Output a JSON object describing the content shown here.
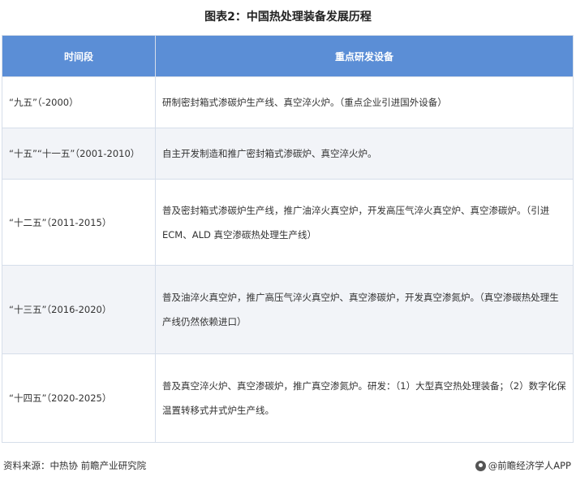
{
  "title": "图表2：中国热处理装备发展历程",
  "table": {
    "headers": [
      "时间段",
      "重点研发设备"
    ],
    "rows": [
      {
        "period": "“九五”（-2000）",
        "equipment": "研制密封箱式渗碳炉生产线、真空淬火炉。（重点企业引进国外设备）"
      },
      {
        "period": "“十五”“十一五”（2001-2010）",
        "equipment": "自主开发制造和推广密封箱式渗碳炉、真空淬火炉。"
      },
      {
        "period": "“十二五”（2011-2015）",
        "equipment": "普及密封箱式渗碳炉生产线，推广油淬火真空炉，开发高压气淬火真空炉、真空渗碳炉。（引进 ECM、ALD 真空渗碳热处理生产线）"
      },
      {
        "period": "“十三五”（2016-2020）",
        "equipment": "普及油淬火真空炉，推广高压气淬火真空炉、真空渗碳炉，开发真空渗氮炉。（真空渗碳热处理生产线仍然依赖进口）"
      },
      {
        "period": "“十四五”（2020-2025）",
        "equipment": "普及真空淬火炉、真空渗碳炉，推广真空渗氮炉。研发：（1）大型真空热处理装备；（2）数字化保温置转移式井式炉生产线。"
      }
    ]
  },
  "footer": {
    "source": "资料来源：中热协 前瞻产业研究院",
    "brand": "@前瞻经济学人APP",
    "brand_icon": "qianzhan-logo-icon"
  }
}
